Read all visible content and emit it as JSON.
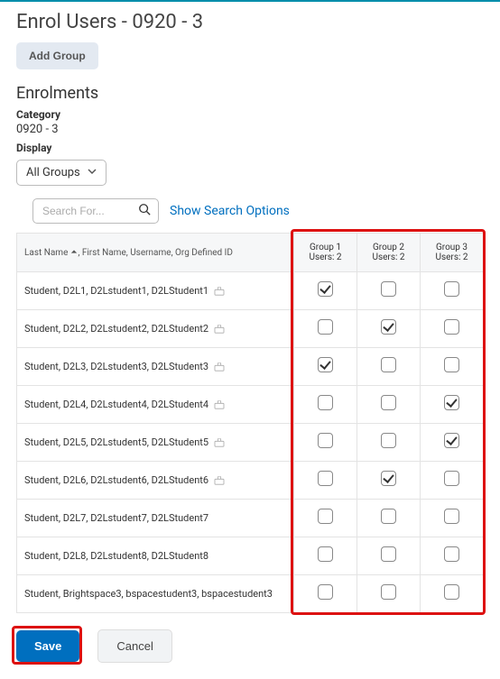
{
  "page_title": "Enrol Users - 0920 - 3",
  "add_group_label": "Add Group",
  "enrolments_heading": "Enrolments",
  "category_label": "Category",
  "category_value": "0920 - 3",
  "display_label": "Display",
  "display_value": "All Groups",
  "search": {
    "placeholder": "Search For...",
    "options_link": "Show Search Options"
  },
  "table": {
    "name_header_sorted": "Last Name",
    "name_header_rest": ", First Name, Username, Org Defined ID",
    "groups": [
      {
        "title": "Group 1",
        "subtitle": "Users: 2"
      },
      {
        "title": "Group 2",
        "subtitle": "Users: 2"
      },
      {
        "title": "Group 3",
        "subtitle": "Users: 2"
      }
    ],
    "rows": [
      {
        "name": "Student, D2L1, D2Lstudent1, D2LStudent1",
        "has_icon": true,
        "checks": [
          true,
          false,
          false
        ]
      },
      {
        "name": "Student, D2L2, D2Lstudent2, D2LStudent2",
        "has_icon": true,
        "checks": [
          false,
          true,
          false
        ]
      },
      {
        "name": "Student, D2L3, D2Lstudent3, D2LStudent3",
        "has_icon": true,
        "checks": [
          true,
          false,
          false
        ]
      },
      {
        "name": "Student, D2L4, D2Lstudent4, D2LStudent4",
        "has_icon": true,
        "checks": [
          false,
          false,
          true
        ]
      },
      {
        "name": "Student, D2L5, D2Lstudent5, D2LStudent5",
        "has_icon": true,
        "checks": [
          false,
          false,
          true
        ]
      },
      {
        "name": "Student, D2L6, D2Lstudent6, D2LStudent6",
        "has_icon": true,
        "checks": [
          false,
          true,
          false
        ]
      },
      {
        "name": "Student, D2L7, D2Lstudent7, D2LStudent7",
        "has_icon": false,
        "checks": [
          false,
          false,
          false
        ]
      },
      {
        "name": "Student, D2L8, D2Lstudent8, D2LStudent8",
        "has_icon": false,
        "checks": [
          false,
          false,
          false
        ]
      },
      {
        "name": "Student, Brightspace3, bspacestudent3, bspacestudent3",
        "has_icon": false,
        "checks": [
          false,
          false,
          false
        ]
      }
    ]
  },
  "footer": {
    "save_label": "Save",
    "cancel_label": "Cancel"
  }
}
